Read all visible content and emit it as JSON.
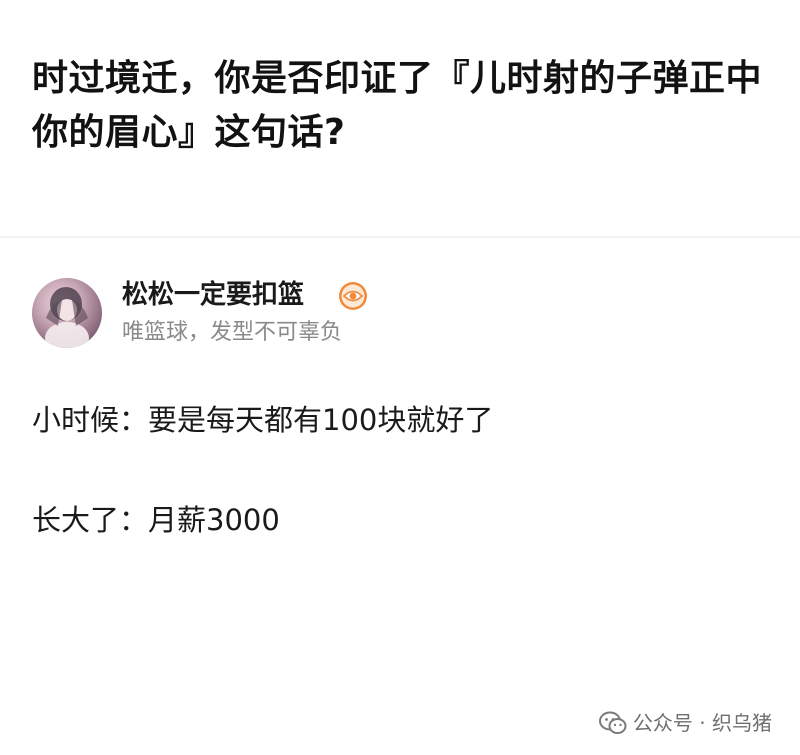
{
  "question": {
    "title": "时过境迁，你是否印证了『儿时射的子弹正中你的眉心』这句话?"
  },
  "author": {
    "name": "松松一定要扣篮",
    "bio": "唯篮球，发型不可辜负",
    "badge_icon": "eye-badge-icon",
    "badge_color": "#f08a3c"
  },
  "answer": {
    "lines": [
      "小时候：要是每天都有100块就好了",
      "长大了：月薪3000"
    ]
  },
  "watermark": {
    "icon": "wechat-icon",
    "text": "公众号 · 织乌猪"
  }
}
